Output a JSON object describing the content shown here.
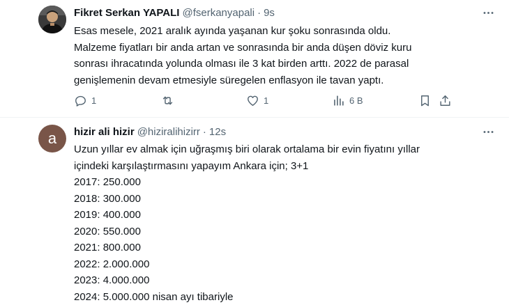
{
  "tweets": [
    {
      "author_name": "Fikret Serkan YAPALI",
      "handle": "@fserkanyapali",
      "separator": "·",
      "time": "9s",
      "avatar_icon": "user-photo-icon",
      "text_lines": [
        "Esas mesele, 2021 aralık ayında yaşanan kur şoku sonrasında oldu.",
        "Malzeme fiyatları bir anda artan ve sonrasında bir anda düşen döviz kuru",
        "sonrası ihracatında yolunda olması ile 3 kat birden arttı. 2022 de parasal",
        "genişlemenin devam etmesiyle süregelen enflasyon ile tavan yaptı."
      ],
      "actions": {
        "replies": "1",
        "retweets": "",
        "likes": "1",
        "views": "6 B"
      }
    },
    {
      "author_name": "hizir ali hizir",
      "handle": "@hiziralihizirr",
      "separator": "·",
      "time": "12s",
      "avatar_letter": "a",
      "avatar_color": "#795548",
      "text_lines": [
        "Uzun yıllar ev almak için uğraşmış biri olarak ortalama bir evin fiyatını yıllar",
        "içindeki karşılaştırmasını yapayım Ankara için; 3+1",
        "2017: 250.000",
        "2018: 300.000",
        "2019: 400.000",
        "2020: 550.000",
        "2021: 800.000",
        "2022: 2.000.000",
        "2023: 4.000.000",
        "2024: 5.000.000 nisan ayı tibariyle"
      ]
    }
  ],
  "colors": {
    "text_primary": "#0f1419",
    "text_secondary": "#536471",
    "divider": "#eff3f4"
  }
}
